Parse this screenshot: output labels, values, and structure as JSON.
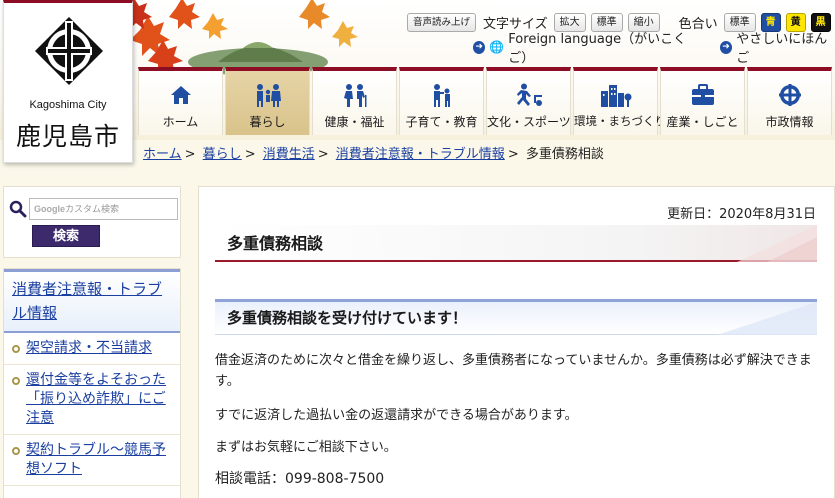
{
  "logo": {
    "name_en": "Kagoshima City",
    "name_ja": "鹿児島市"
  },
  "toolbar": {
    "read_aloud": "音声読み上げ",
    "font_size_label": "文字サイズ",
    "enlarge": "拡大",
    "standard": "標準",
    "shrink": "縮小",
    "color_label": "色合い",
    "color_standard": "標準",
    "color_blue": "青",
    "color_yellow": "黄",
    "color_black": "黒",
    "foreign_language": "Foreign language（がいこくご）",
    "easy_japanese": "やさしいにほんご"
  },
  "nav": {
    "items": [
      {
        "label": "ホーム",
        "icon": "home-icon"
      },
      {
        "label": "暮らし",
        "icon": "family-icon"
      },
      {
        "label": "健康・福祉",
        "icon": "welfare-icon"
      },
      {
        "label": "子育て・教育",
        "icon": "childcare-icon"
      },
      {
        "label": "文化・スポーツ",
        "icon": "sports-icon"
      },
      {
        "label": "環境・まちづくり",
        "icon": "town-icon"
      },
      {
        "label": "産業・しごと",
        "icon": "briefcase-icon"
      },
      {
        "label": "市政情報",
        "icon": "city-emblem-icon"
      }
    ]
  },
  "breadcrumb": {
    "home": "ホーム",
    "life": "暮らし",
    "consumer": "消費生活",
    "alerts": "消費者注意報・トラブル情報",
    "current": "多重債務相談"
  },
  "search": {
    "placeholder": "カスタム検索",
    "google": "Google",
    "button": "検索"
  },
  "sidebar": {
    "title": "消費者注意報・トラブル情報",
    "items": [
      {
        "label": "架空請求・不当請求"
      },
      {
        "label": "還付金等をよそおった「振り込め詐欺」にご注意"
      },
      {
        "label": "契約トラブル～競馬予想ソフト"
      }
    ]
  },
  "main": {
    "updated": "更新日：2020年8月31日",
    "title": "多重債務相談",
    "subtitle": "多重債務相談を受け付けています！",
    "paragraphs": [
      "借金返済のために次々と借金を繰り返し、多重債務者になっていませんか。多重債務は必ず解決できます。",
      "すでに返済した過払い金の返還請求ができる場合があります。",
      "まずはお気軽にご相談下さい。",
      "相談電話：099-808-7500"
    ]
  },
  "colors": {
    "brand_red": "#8d0d24",
    "link_blue": "#1a3fa0",
    "search_button": "#3c2a6d",
    "accent_blue": "#8ea4d9"
  }
}
